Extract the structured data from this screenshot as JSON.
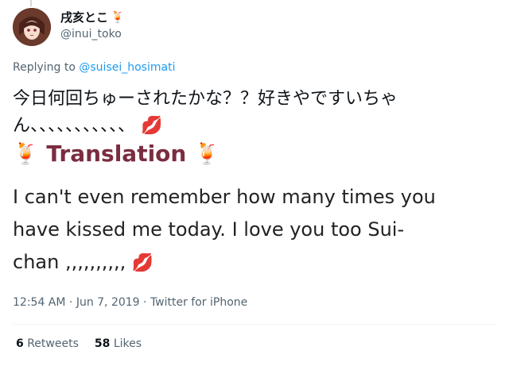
{
  "author": {
    "display_name": "戌亥とこ",
    "name_emoji": "🍹",
    "handle": "@inui_toko"
  },
  "reply": {
    "prefix": "Replying to ",
    "target": "@suisei_hosimati"
  },
  "tweet": {
    "text_line1": "今日何回ちゅーされたかな？？好きやですいちゃ",
    "text_line2": "ん、、、、、、、、、、、",
    "emoji": "💋"
  },
  "translation": {
    "left_emoji": "🍹",
    "title": "Translation",
    "right_emoji": "🍹",
    "text_line1": "I can't even remember how many times you",
    "text_line2": "have kissed me today. I love you too Sui-",
    "text_line3": "chan ,,,,,,,,,,",
    "emoji": "💋"
  },
  "meta": {
    "time": "12:54 AM",
    "sep1": " · ",
    "date": "Jun 7, 2019",
    "sep2": " · ",
    "source": "Twitter for iPhone"
  },
  "stats": {
    "retweets_count": "6",
    "retweets_label": "Retweets",
    "likes_count": "58",
    "likes_label": "Likes"
  }
}
